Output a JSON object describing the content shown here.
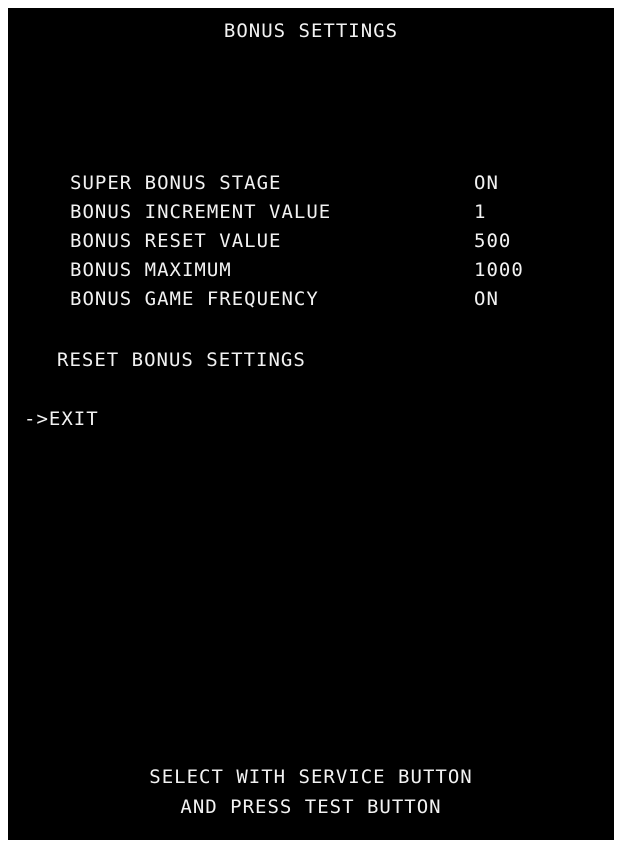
{
  "title": "BONUS SETTINGS",
  "settings": [
    {
      "label": "SUPER BONUS STAGE",
      "value": "ON"
    },
    {
      "label": "BONUS INCREMENT VALUE",
      "value": "1"
    },
    {
      "label": "BONUS RESET VALUE",
      "value": "500"
    },
    {
      "label": "BONUS MAXIMUM",
      "value": "1000"
    },
    {
      "label": "BONUS GAME FREQUENCY",
      "value": "ON"
    }
  ],
  "reset_label": "RESET BONUS SETTINGS",
  "exit_label": "->EXIT",
  "footer": {
    "line1": "SELECT WITH SERVICE BUTTON",
    "line2": "AND PRESS TEST BUTTON"
  },
  "colors": {
    "background": "#000000",
    "text": "#f2f2f2"
  }
}
